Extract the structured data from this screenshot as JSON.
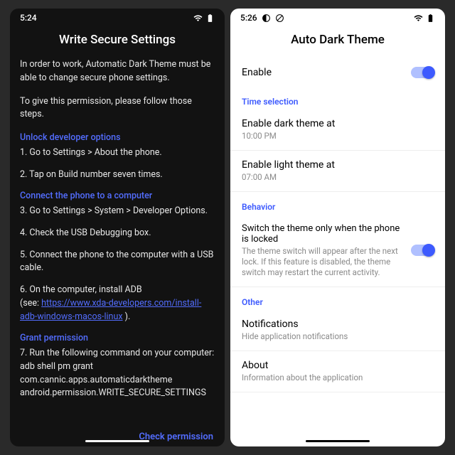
{
  "left": {
    "status_time": "5:24",
    "title": "Write Secure Settings",
    "intro1": "In order to work, Automatic Dark Theme must be able to change secure phone settings.",
    "intro2": "To give this permission, please follow those steps.",
    "sec1_head": "Unlock developer options",
    "step1": "1. Go to Settings > About the phone.",
    "step2": "2. Tap on Build number seven times.",
    "sec2_head": "Connect the phone to a computer",
    "step3": "3. Go to Settings > System > Developer Options.",
    "step4": "4. Check the USB Debugging box.",
    "step5": "5. Connect the phone to the computer with a USB cable.",
    "step6a": "6. On the computer, install ADB",
    "step6b": "(see: ",
    "step6_link": "https://www.xda-developers.com/install-adb-windows-macos-linux",
    "step6c": " ).",
    "sec3_head": "Grant permission",
    "step7a": "7. Run the following command on your computer:",
    "step7b": "adb shell pm grant com.cannic.apps.automaticdarktheme android.permission.WRITE_SECURE_SETTINGS",
    "check_btn": "Check permission"
  },
  "right": {
    "status_time": "5:26",
    "title": "Auto Dark Theme",
    "enable_label": "Enable",
    "cat_time": "Time selection",
    "dark_at_label": "Enable dark theme at",
    "dark_at_value": "10:00 PM",
    "light_at_label": "Enable light theme at",
    "light_at_value": "07:00 AM",
    "cat_behavior": "Behavior",
    "lock_label": "Switch the theme only when the phone is locked",
    "lock_sub": "The theme switch will appear after the next lock. If this feature is disabled, the theme switch may restart the current activity.",
    "cat_other": "Other",
    "notif_label": "Notifications",
    "notif_sub": "Hide application notifications",
    "about_label": "About",
    "about_sub": "Information about the application"
  }
}
